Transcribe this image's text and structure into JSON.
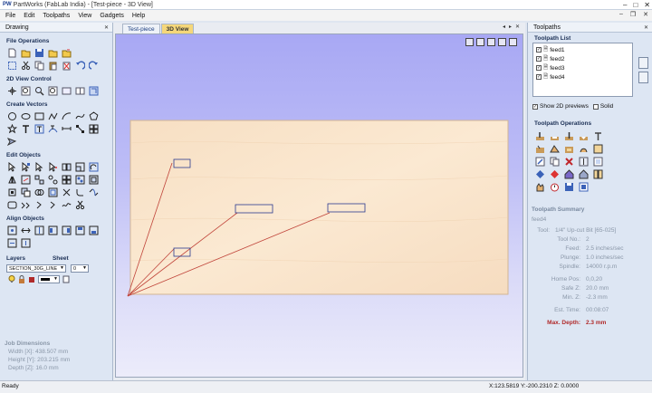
{
  "window": {
    "logo": "PW",
    "title": "PartWorks (FabLab India) - [Test-piece - 3D View]"
  },
  "menu": [
    "File",
    "Edit",
    "Toolpaths",
    "View",
    "Gadgets",
    "Help"
  ],
  "left_panel": {
    "title": "Drawing",
    "sections": {
      "file_operations": "File Operations",
      "view_control": "2D View Control",
      "create_vectors": "Create Vectors",
      "edit_objects": "Edit Objects",
      "align_objects": "Align Objects"
    },
    "layers_label": "Layers",
    "sheet_label": "Sheet",
    "layer_value": "SECTION_30G_LINE",
    "sheet_value": "0",
    "job": {
      "title": "Job Dimensions",
      "width": "Width  [X]: 438.507 mm",
      "height": "Height [Y]: 203.215 mm",
      "depth": "Depth  [Z]: 16.0 mm"
    }
  },
  "view": {
    "tabs": [
      "Test-piece",
      "3D View"
    ],
    "active_tab": "3D View"
  },
  "right_panel": {
    "title": "Toolpaths",
    "list_title": "Toolpath List",
    "toolpaths": [
      "feed1",
      "feed2",
      "feed3",
      "feed4"
    ],
    "show_2d_previews": "Show 2D previews",
    "solid": "Solid",
    "operations_title": "Toolpath Operations",
    "summary": {
      "title": "Toolpath Summary",
      "name": "feed4",
      "rows": [
        {
          "k": "Tool:",
          "v": "1/4\" Up-cut Bit [65-025]"
        },
        {
          "k": "Tool No.:",
          "v": "2"
        },
        {
          "k": "Feed:",
          "v": "2.5 inches/sec"
        },
        {
          "k": "Plunge:",
          "v": "1.0 inches/sec"
        },
        {
          "k": "Spindle:",
          "v": "14000 r.p.m"
        }
      ],
      "rows2": [
        {
          "k": "Home Pos:",
          "v": "0,0,20"
        },
        {
          "k": "Safe Z:",
          "v": "20.0 mm"
        },
        {
          "k": "Min. Z:",
          "v": "-2.3 mm"
        }
      ],
      "est_time_k": "Est. Time:",
      "est_time_v": "00:08:07",
      "max_depth_k": "Max. Depth:",
      "max_depth_v": "2.3 mm"
    }
  },
  "status": {
    "ready": "Ready",
    "coords": "X:123.5819 Y:-200.2310 Z:  0.0000"
  },
  "colors": {
    "accent_tab": "#f5d77a",
    "toolpath_line": "#c0443a",
    "vector_rect": "#2b3a8f"
  }
}
